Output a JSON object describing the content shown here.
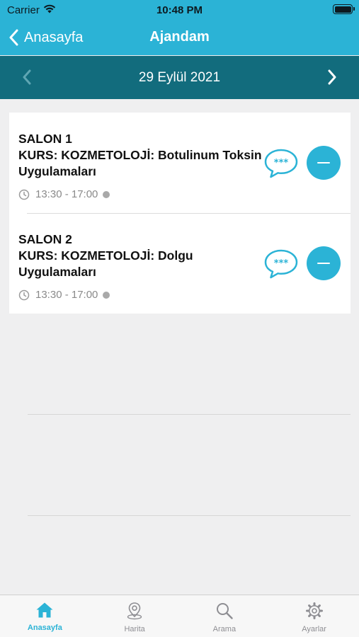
{
  "status_bar": {
    "carrier": "Carrier",
    "time": "10:48 PM"
  },
  "nav": {
    "back_label": "Anasayfa",
    "title": "Ajandam"
  },
  "date_bar": {
    "date": "29 Eylül 2021"
  },
  "items": [
    {
      "salon": "SALON 1",
      "course": "KURS: KOZMETOLOJİ: Botulinum Toksin Uygulamaları",
      "time": "13:30 - 17:00"
    },
    {
      "salon": "SALON 2",
      "course": "KURS: KOZMETOLOJİ: Dolgu Uygulamaları",
      "time": "13:30 - 17:00"
    }
  ],
  "tabs": [
    {
      "label": "Anasayfa",
      "icon": "home-icon",
      "active": true
    },
    {
      "label": "Harita",
      "icon": "map-pin-icon",
      "active": false
    },
    {
      "label": "Arama",
      "icon": "search-icon",
      "active": false
    },
    {
      "label": "Ayarlar",
      "icon": "gear-icon",
      "active": false
    }
  ],
  "colors": {
    "accent": "#2bb3d6",
    "date_bar": "#126c7d",
    "background": "#efeff0"
  }
}
